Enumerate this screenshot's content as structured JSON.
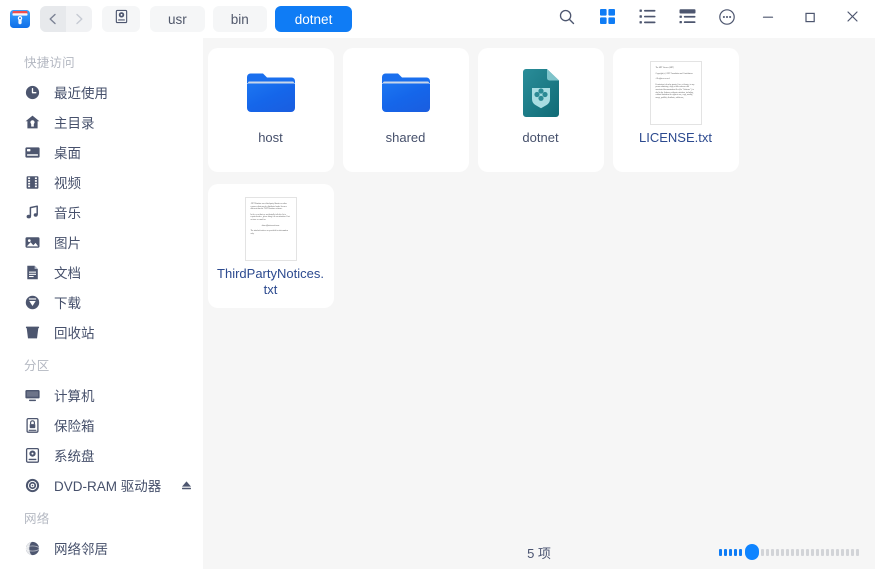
{
  "titlebar": {
    "app_icon": "file-manager-icon",
    "back_label": "back-arrow-icon",
    "forward_label": "forward-arrow-icon",
    "disk_label": "hard-disk-icon",
    "breadcrumbs": [
      {
        "label": "usr",
        "active": false
      },
      {
        "label": "bin",
        "active": false
      },
      {
        "label": "dotnet",
        "active": true
      }
    ],
    "actions": [
      {
        "name": "search-icon",
        "label": "搜索"
      },
      {
        "name": "icon-view-icon",
        "label": "图标视图",
        "active": true
      },
      {
        "name": "list-view-icon",
        "label": "列表视图",
        "active": false
      },
      {
        "name": "detail-view-icon",
        "label": "详细视图",
        "active": false
      },
      {
        "name": "more-options-icon",
        "label": "更多选项"
      }
    ],
    "window_controls": [
      {
        "name": "minimize-button",
        "label": "最小化"
      },
      {
        "name": "maximize-button",
        "label": "最大化"
      },
      {
        "name": "close-button",
        "label": "关闭"
      }
    ]
  },
  "sidebar": {
    "groups": [
      {
        "title": "快捷访问",
        "items": [
          {
            "label": "最近使用",
            "icon": "clock-icon"
          },
          {
            "label": "主目录",
            "icon": "home-icon"
          },
          {
            "label": "桌面",
            "icon": "desktop-icon"
          },
          {
            "label": "视频",
            "icon": "film-icon"
          },
          {
            "label": "音乐",
            "icon": "music-note-icon"
          },
          {
            "label": "图片",
            "icon": "image-icon"
          },
          {
            "label": "文档",
            "icon": "document-icon"
          },
          {
            "label": "下载",
            "icon": "download-icon"
          },
          {
            "label": "回收站",
            "icon": "trash-icon"
          }
        ]
      },
      {
        "title": "分区",
        "items": [
          {
            "label": "计算机",
            "icon": "monitor-icon"
          },
          {
            "label": "保险箱",
            "icon": "safe-lock-icon"
          },
          {
            "label": "系统盘",
            "icon": "system-disk-icon"
          },
          {
            "label": "DVD-RAM 驱动器",
            "icon": "optical-disc-icon",
            "eject": true
          }
        ]
      },
      {
        "title": "网络",
        "items": [
          {
            "label": "网络邻居",
            "icon": "network-globe-icon"
          }
        ]
      }
    ]
  },
  "main": {
    "files": [
      {
        "name": "host",
        "type": "folder",
        "icon": "blue-folder-icon"
      },
      {
        "name": "shared",
        "type": "folder",
        "icon": "blue-folder-icon"
      },
      {
        "name": "dotnet",
        "type": "executable",
        "icon": "dotnet-package-icon"
      },
      {
        "name": "LICENSE.txt",
        "type": "text",
        "icon": "text-file-thumbnail",
        "preview": [
          "The MIT License (MIT)",
          "Copyright (c) .NET Foundation and Contributors",
          "All rights reserved.",
          "Permission is hereby granted, free of charge, to any person obtaining a copy of this software and associated documentation files (the \"Software\"), to deal in the Software without restriction, including without limitation the rights to use, copy, modify, merge, publish, distribute, sublicense,"
        ]
      },
      {
        "name": "ThirdPartyNotices.txt",
        "type": "text",
        "icon": "text-file-thumbnail",
        "preview": [
          ".NET Runtime uses third-party libraries or other resources that may be distributed under licenses different than the .NET Runtime software.",
          "In the event that we accidentally failed to list a required notice, please bring it to our attention. Post an issue or email us:",
          "dotnet@microsoft.com",
          "The attached notices are provided for information only."
        ]
      }
    ]
  },
  "statusbar": {
    "count_text": "5 项",
    "zoom_slider": {
      "name": "icon-size-slider",
      "filled_ticks": 5,
      "empty_ticks": 20
    }
  },
  "colors": {
    "accent": "#0f7cf5",
    "accent_bright": "#0f84ff",
    "sidebar_bg": "#ffffff",
    "main_bg": "#f6f6f6",
    "text": "#46506b",
    "muted": "#b4b8c2",
    "folder_blue": "#1466e8",
    "dotnet_teal": "#1b7f8c"
  }
}
